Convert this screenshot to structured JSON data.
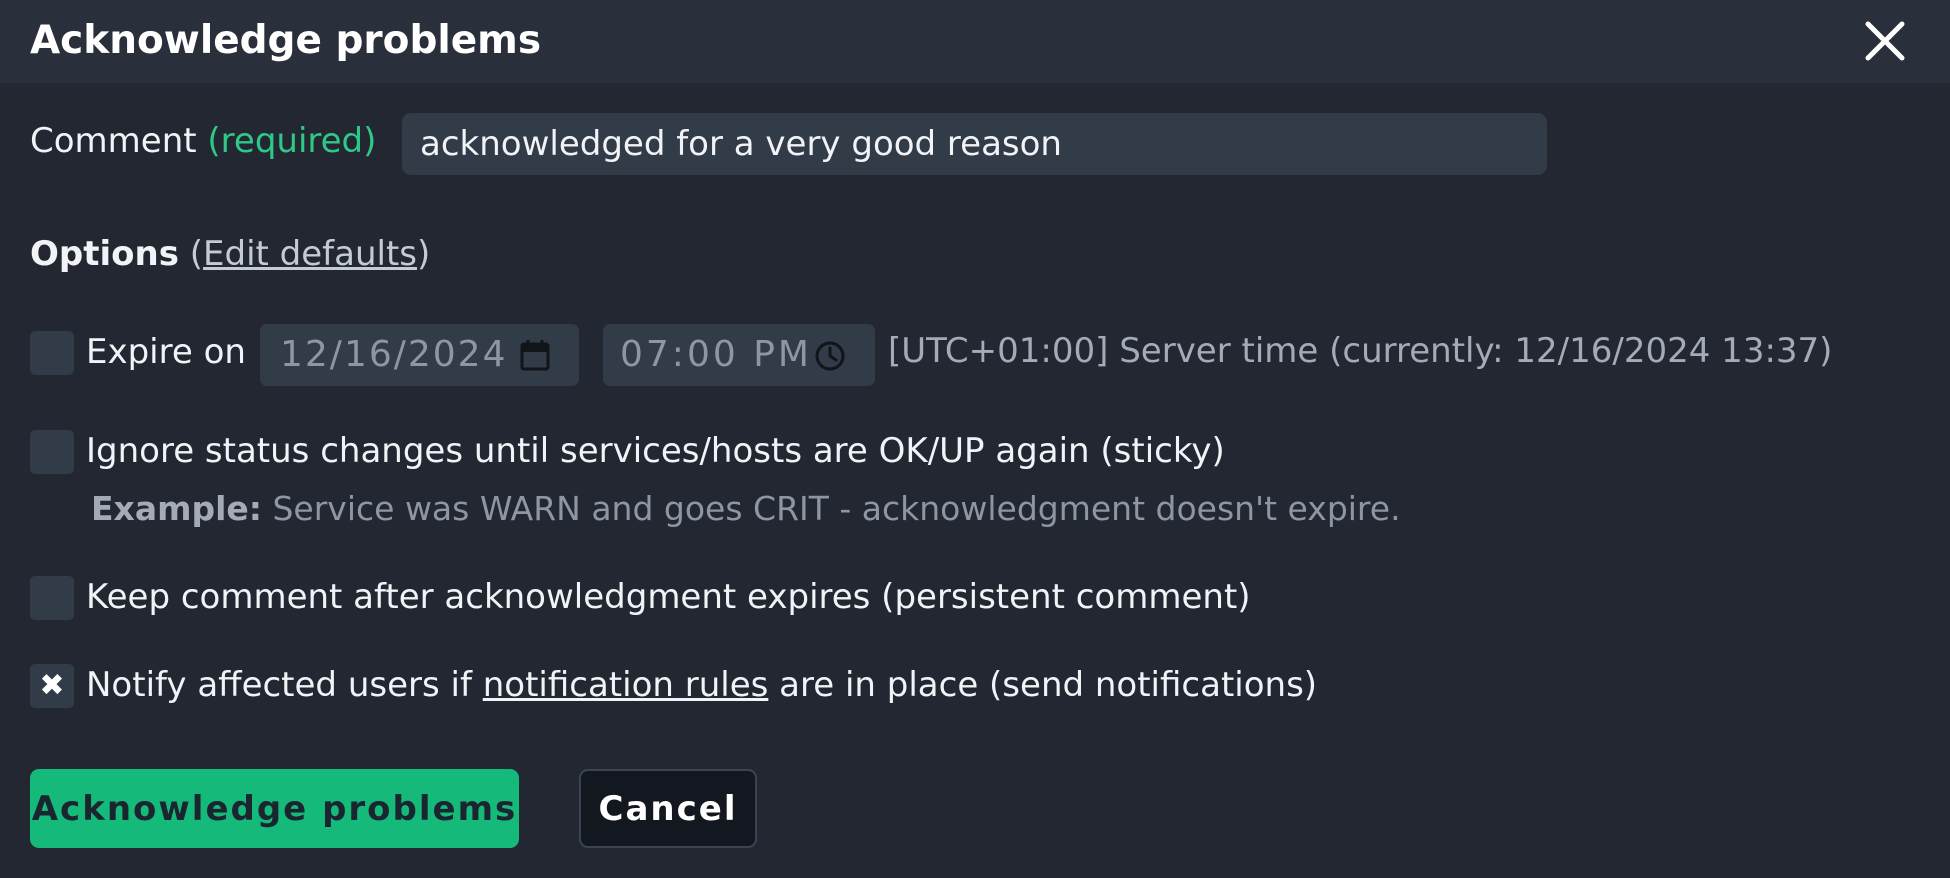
{
  "dialog": {
    "title": "Acknowledge problems",
    "close_icon": "close-icon"
  },
  "comment": {
    "label": "Comment",
    "required_label": "(required)",
    "value": "acknowledged for a very good reason"
  },
  "options": {
    "label": "Options",
    "paren_open": "(",
    "edit_defaults_link": "Edit defaults",
    "paren_close": ")"
  },
  "expire": {
    "checked": false,
    "label": "Expire on",
    "date_value": "12/16/2024",
    "date_icon": "calendar-icon",
    "time_value": "07:00 PM",
    "time_icon": "clock-icon",
    "server_time_note": "[UTC+01:00] Server time (currently: 12/16/2024 13:37)"
  },
  "sticky": {
    "checked": false,
    "label": "Ignore status changes until services/hosts are OK/UP again (sticky)",
    "example_label": "Example:",
    "example_text": " Service was WARN and goes CRIT - acknowledgment doesn't expire."
  },
  "persistent": {
    "checked": false,
    "label": "Keep comment after acknowledgment expires (persistent comment)"
  },
  "notify": {
    "checked": true,
    "check_mark": "✖",
    "label_prefix": "Notify affected users if ",
    "link_text": "notification rules",
    "label_suffix": " are in place (send notifications)"
  },
  "buttons": {
    "submit_label": "Acknowledge problems",
    "cancel_label": "Cancel"
  },
  "colors": {
    "accent_green": "#15b97a",
    "required_green": "#2ec887",
    "background": "#222732",
    "header": "#2a303b",
    "field": "#323b48"
  }
}
